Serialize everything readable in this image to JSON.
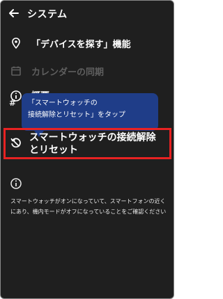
{
  "header": {
    "title": "システム",
    "back_icon": "back-arrow-icon"
  },
  "items": {
    "find_device": {
      "label": "「デバイスを探す」機能",
      "icon": "location-pin-icon",
      "enabled": true
    },
    "calendar_sync": {
      "label": "カレンダーの同期",
      "icon": "calendar-icon",
      "enabled": false
    },
    "overview": {
      "label": "概要",
      "icon": "info-icon",
      "enabled": true
    },
    "hash_row": {
      "glyph": "#"
    },
    "reset": {
      "label": "スマートウォッチの接続解除とリセット",
      "icon": "reset-icon",
      "enabled": true
    }
  },
  "tooltip": {
    "line1": "「スマートウォッチの",
    "line2": "接続解除とリセット」をタップ"
  },
  "info_note": {
    "icon": "info-icon",
    "text": "スマートウォッチがオンになっていて、スマートフォンの近くにあり、機内モードがオフになっていることをご確認ください"
  },
  "colors": {
    "background": "#1f1f1f",
    "tooltip": "#1f3d88",
    "highlight_border": "#e82222",
    "disabled_text": "#5f5f5f"
  }
}
